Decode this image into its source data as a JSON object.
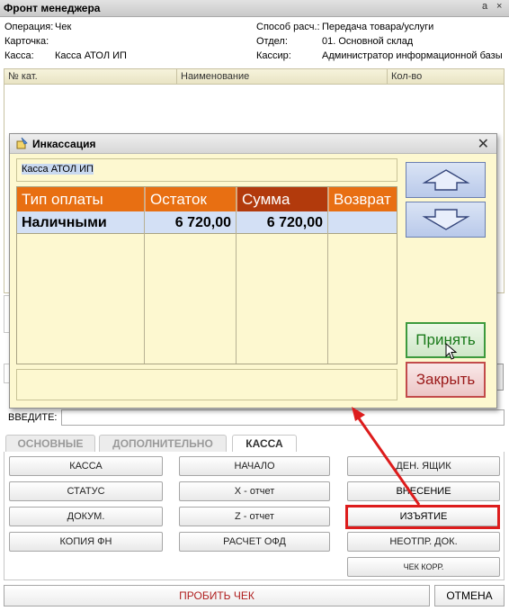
{
  "window": {
    "title": "Фронт менеджера",
    "controls": [
      "a",
      "×"
    ]
  },
  "header": {
    "operation_label": "Операция:",
    "operation_value": "Чек",
    "card_label": "Карточка:",
    "register_label": "Касса:",
    "register_value": "Касса АТОЛ ИП",
    "paymethod_label": "Способ расч.:",
    "paymethod_value": "Передача товара/услуги",
    "department_label": "Отдел:",
    "department_value": "01. Основной склад",
    "cashier_label": "Кассир:",
    "cashier_value": "Администратор информационной базы"
  },
  "main_table": {
    "columns": [
      "№ кат.",
      "Наименование",
      "Кол-во"
    ]
  },
  "entry": {
    "label": "ВВЕДИТЕ:",
    "value": ""
  },
  "tabs": [
    {
      "label": "ОСНОВНЫЕ",
      "active": false
    },
    {
      "label": "ДОПОЛНИТЕЛЬНО",
      "active": false
    },
    {
      "label": "КАССА",
      "active": true
    }
  ],
  "buttons": {
    "col1": [
      "КАССА",
      "СТАТУС",
      "ДОКУМ.",
      "КОПИЯ ФН"
    ],
    "col2": [
      "НАЧАЛО",
      "X - отчет",
      "Z - отчет",
      "РАСЧЕТ ОФД"
    ],
    "col3": [
      "ДЕН. ЯЩИК",
      "ВНЕСЕНИЕ",
      "ИЗЪЯТИЕ",
      "НЕОТПР. ДОК.",
      "ЧЕК КОРР."
    ]
  },
  "bottom": {
    "print_check": "ПРОБИТЬ ЧЕК",
    "cancel": "ОТМЕНА"
  },
  "dialog": {
    "title": "Инкассация",
    "register": "Касса АТОЛ ИП",
    "columns": [
      "Тип оплаты",
      "Остаток",
      "Сумма",
      "Возврат"
    ],
    "rows": [
      {
        "type": "Наличными",
        "balance": "6 720,00",
        "amount": "6 720,00",
        "refund": ""
      }
    ],
    "accept_label": "Принять",
    "close_label": "Закрыть",
    "up_icon": "arrow-up-icon",
    "down_icon": "arrow-down-icon"
  },
  "colors": {
    "header_orange": "#e86f12",
    "header_dark": "#b23a0c",
    "dialog_bg": "#fdf8d0",
    "highlight_red": "#dd1c1c"
  }
}
